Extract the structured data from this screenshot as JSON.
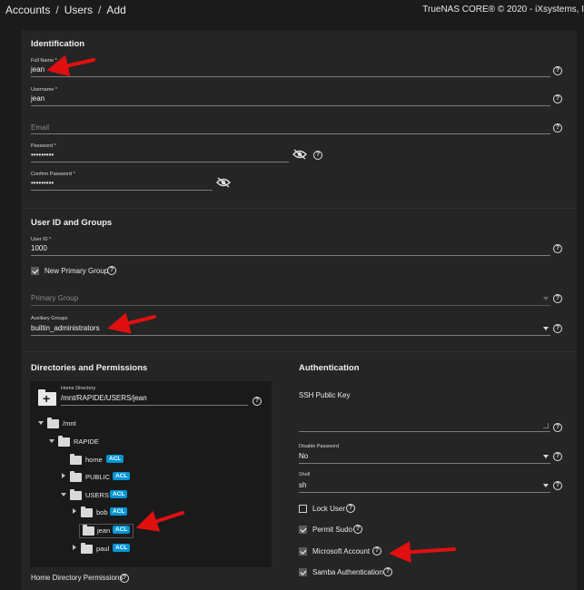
{
  "breadcrumb": [
    "Accounts",
    "Users",
    "Add"
  ],
  "brand": "TrueNAS CORE® © 2020 - iXsystems, I",
  "identification": {
    "title": "Identification",
    "full_name_label": "Full Name *",
    "full_name_value": "jean",
    "username_label": "Username *",
    "username_value": "jean",
    "email_placeholder": "Email",
    "password_label": "Password *",
    "password_value": "•••••••••",
    "confirm_label": "Confirm Password *",
    "confirm_value": "•••••••••"
  },
  "groups": {
    "title": "User ID and Groups",
    "user_id_label": "User ID *",
    "user_id_value": "1000",
    "new_primary_group_label": "New Primary Group",
    "new_primary_group_checked": true,
    "primary_group_placeholder": "Primary Group",
    "aux_label": "Auxiliary Groups",
    "aux_value": "builtin_administrators"
  },
  "directories": {
    "title": "Directories and Permissions",
    "home_dir_label": "Home Directory",
    "home_dir_value": "/mnt/RAPIDE/USERS/jean",
    "acl_badge": "ACL",
    "tree": {
      "mnt": "/mnt",
      "rapide": "RAPIDE",
      "home": "home",
      "public": "PUBLIC",
      "users": "USERS",
      "bob": "bob",
      "jean": "jean",
      "paul": "paul"
    },
    "home_perm_label": "Home Directory Permissions"
  },
  "authentication": {
    "title": "Authentication",
    "ssh_label": "SSH Public Key",
    "disable_password_label": "Disable Password",
    "disable_password_value": "No",
    "shell_label": "Shell",
    "shell_value": "sh",
    "lock_user_label": "Lock User",
    "lock_user_checked": false,
    "permit_sudo_label": "Permit Sudo",
    "permit_sudo_checked": true,
    "microsoft_label": "Microsoft Account",
    "microsoft_checked": true,
    "samba_label": "Samba Authentication",
    "samba_checked": true
  },
  "colors": {
    "background": "#1b1b1b",
    "card": "#252525",
    "acl_badge": "#0095d5",
    "annotation_arrow": "#e01010"
  }
}
